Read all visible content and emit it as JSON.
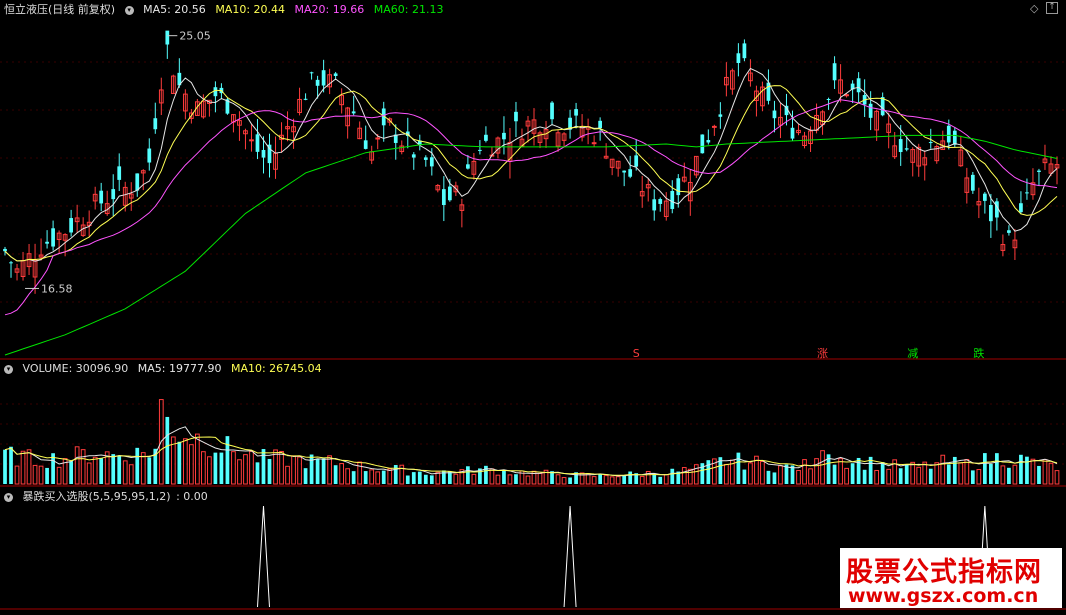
{
  "header_main": {
    "title": "恒立液压(日线 前复权)",
    "ma5": "MA5: 20.56",
    "ma10": "MA10: 20.44",
    "ma20": "MA20: 19.66",
    "ma60": "MA60: 21.13"
  },
  "header_volume": {
    "title": "VOLUME: 30096.90",
    "ma5": "MA5: 19777.90",
    "ma10": "MA10: 26745.04"
  },
  "header_indicator": {
    "title": "暴跌买入选股(5,5,95,95,1,2)",
    "value": ": 0.00"
  },
  "colors": {
    "up": "#ff3c3c",
    "down": "#54ffff",
    "ma5": "#e6e6e6",
    "ma10": "#ffff54",
    "ma20": "#ff54ff",
    "ma60": "#00e600",
    "divider": "#a00000",
    "grid": "#6e0000"
  },
  "chart_data": {
    "type": "candlestick",
    "n_bars": 176,
    "price_range": [
      14.0,
      25.8
    ],
    "max_label": "25.05",
    "min_label": "16.58",
    "max_bar": 27,
    "min_bar": 2,
    "close_anchors": [
      [
        0,
        17.6
      ],
      [
        2,
        16.9
      ],
      [
        6,
        17.8
      ],
      [
        10,
        18.3
      ],
      [
        14,
        19.0
      ],
      [
        18,
        19.6
      ],
      [
        22,
        19.9
      ],
      [
        24,
        20.7
      ],
      [
        26,
        23.6
      ],
      [
        27,
        24.6
      ],
      [
        29,
        23.3
      ],
      [
        32,
        22.5
      ],
      [
        35,
        23.0
      ],
      [
        38,
        22.6
      ],
      [
        41,
        21.3
      ],
      [
        44,
        20.6
      ],
      [
        47,
        21.9
      ],
      [
        50,
        23.1
      ],
      [
        52,
        23.6
      ],
      [
        55,
        23.3
      ],
      [
        58,
        22.4
      ],
      [
        61,
        21.0
      ],
      [
        64,
        21.9
      ],
      [
        67,
        21.2
      ],
      [
        70,
        20.7
      ],
      [
        73,
        19.3
      ],
      [
        76,
        19.6
      ],
      [
        79,
        21.3
      ],
      [
        82,
        21.4
      ],
      [
        86,
        21.9
      ],
      [
        90,
        22.2
      ],
      [
        93,
        22.0
      ],
      [
        96,
        21.9
      ],
      [
        99,
        21.6
      ],
      [
        102,
        20.5
      ],
      [
        105,
        20.1
      ],
      [
        108,
        19.3
      ],
      [
        111,
        19.5
      ],
      [
        114,
        20.3
      ],
      [
        117,
        21.6
      ],
      [
        120,
        23.2
      ],
      [
        122,
        24.1
      ],
      [
        124,
        23.6
      ],
      [
        127,
        22.5
      ],
      [
        130,
        22.0
      ],
      [
        133,
        21.7
      ],
      [
        136,
        22.8
      ],
      [
        139,
        23.4
      ],
      [
        142,
        22.9
      ],
      [
        145,
        22.0
      ],
      [
        148,
        21.6
      ],
      [
        151,
        20.9
      ],
      [
        154,
        21.3
      ],
      [
        157,
        21.6
      ],
      [
        160,
        20.2
      ],
      [
        162,
        19.3
      ],
      [
        165,
        18.6
      ],
      [
        167,
        17.9
      ],
      [
        169,
        18.7
      ],
      [
        171,
        19.9
      ],
      [
        173,
        20.4
      ],
      [
        175,
        20.6
      ]
    ],
    "ma60_anchors": [
      [
        0,
        14.0
      ],
      [
        10,
        14.7
      ],
      [
        20,
        15.6
      ],
      [
        30,
        16.9
      ],
      [
        40,
        18.9
      ],
      [
        50,
        20.3
      ],
      [
        60,
        21.0
      ],
      [
        70,
        21.3
      ],
      [
        80,
        21.2
      ],
      [
        90,
        21.2
      ],
      [
        100,
        21.2
      ],
      [
        110,
        21.3
      ],
      [
        115,
        21.2
      ],
      [
        120,
        21.3
      ],
      [
        130,
        21.4
      ],
      [
        140,
        21.5
      ],
      [
        150,
        21.6
      ],
      [
        158,
        21.6
      ],
      [
        163,
        21.4
      ],
      [
        168,
        21.1
      ],
      [
        175,
        20.8
      ]
    ],
    "volume": {
      "range": [
        0,
        62000
      ],
      "anchors": [
        [
          0,
          18000
        ],
        [
          5,
          15000
        ],
        [
          10,
          16000
        ],
        [
          15,
          19000
        ],
        [
          20,
          17000
        ],
        [
          25,
          21000
        ],
        [
          26,
          46000
        ],
        [
          27,
          40000
        ],
        [
          29,
          32000
        ],
        [
          33,
          27000
        ],
        [
          37,
          22000
        ],
        [
          42,
          16000
        ],
        [
          48,
          15000
        ],
        [
          55,
          13000
        ],
        [
          60,
          10000
        ],
        [
          65,
          9000
        ],
        [
          70,
          7000
        ],
        [
          76,
          8000
        ],
        [
          80,
          9000
        ],
        [
          86,
          7000
        ],
        [
          92,
          6000
        ],
        [
          98,
          5000
        ],
        [
          104,
          6000
        ],
        [
          110,
          7000
        ],
        [
          115,
          9000
        ],
        [
          120,
          15000
        ],
        [
          125,
          13000
        ],
        [
          130,
          10000
        ],
        [
          135,
          12000
        ],
        [
          136,
          30000
        ],
        [
          138,
          16000
        ],
        [
          142,
          14000
        ],
        [
          148,
          11000
        ],
        [
          152,
          10000
        ],
        [
          156,
          13000
        ],
        [
          160,
          12000
        ],
        [
          165,
          16000
        ],
        [
          169,
          15000
        ],
        [
          175,
          10000
        ]
      ]
    },
    "markers": [
      {
        "bar": 105,
        "text": "S",
        "color": "#ff3c3c"
      },
      {
        "bar": 136,
        "text": "涨",
        "color": "#ff3c3c"
      },
      {
        "bar": 151,
        "text": "减",
        "color": "#00e600"
      },
      {
        "bar": 162,
        "text": "跌",
        "color": "#00e600"
      }
    ],
    "signal_spikes": [
      43,
      94,
      163
    ]
  },
  "watermark": {
    "line1": "股票公式指标网",
    "line2": "www.gszx.com.cn"
  }
}
